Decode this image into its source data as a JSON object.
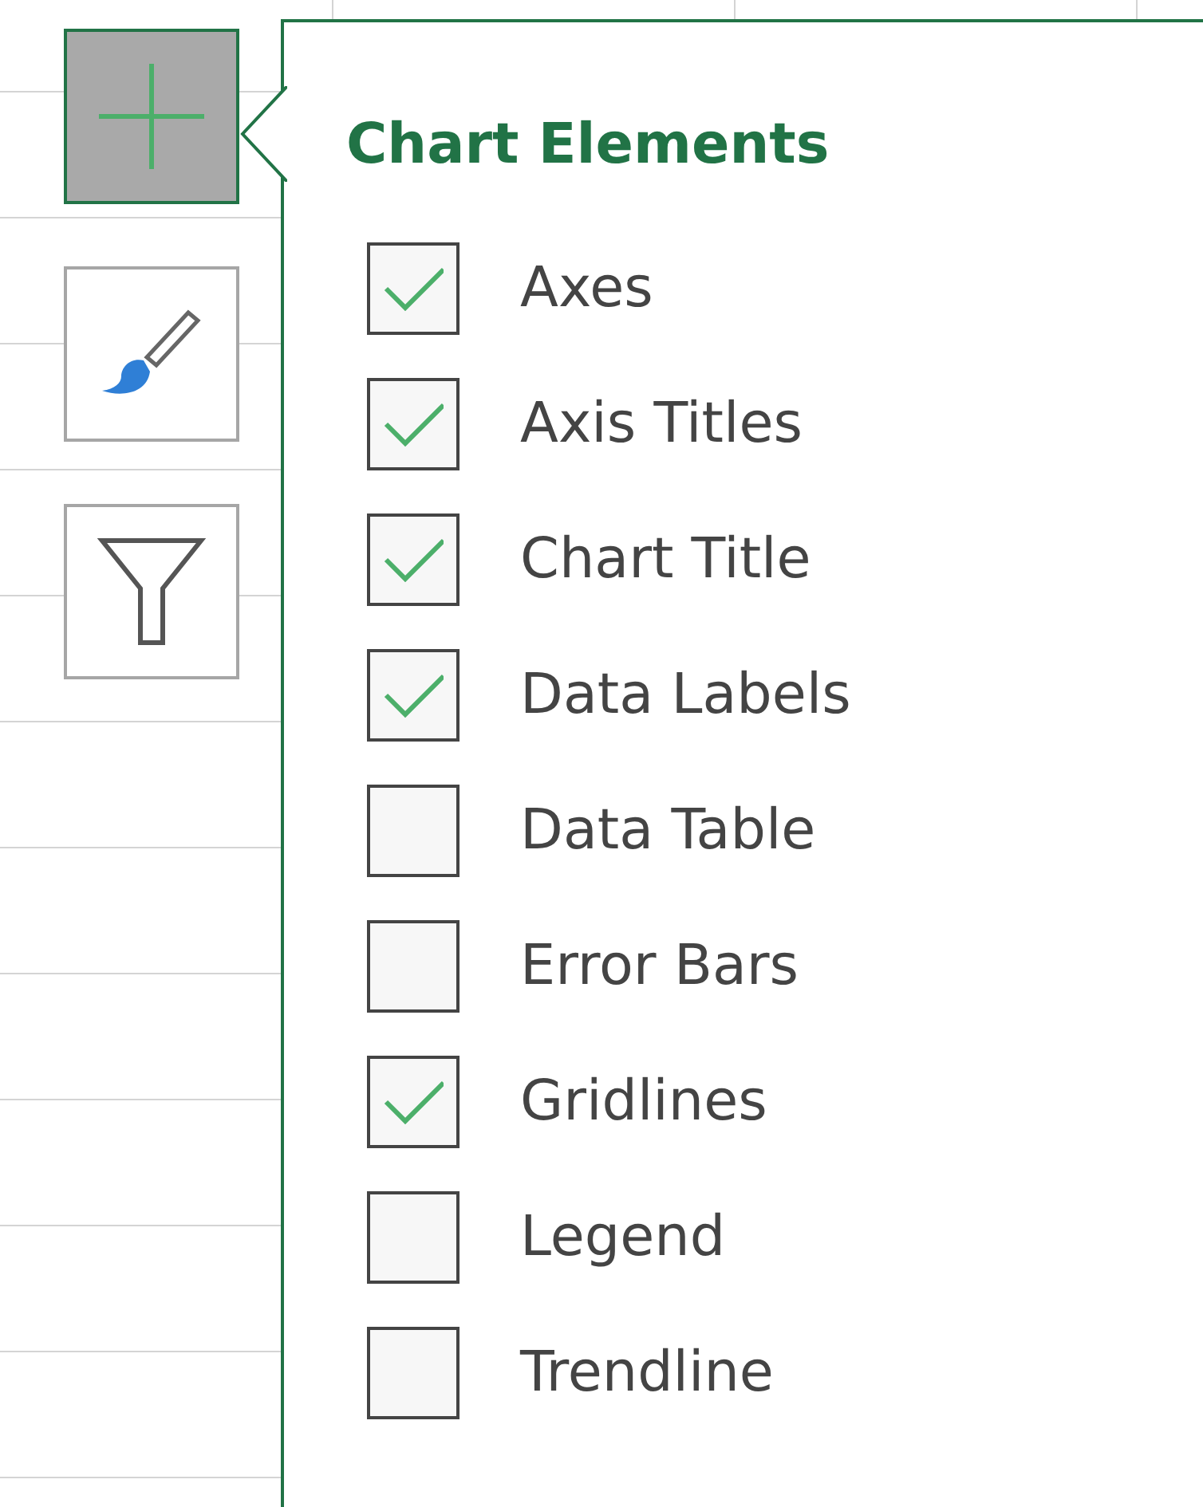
{
  "side_buttons": [
    {
      "kind": "add",
      "selected": true
    },
    {
      "kind": "style",
      "selected": false
    },
    {
      "kind": "filter",
      "selected": false
    }
  ],
  "panel": {
    "title": "Chart Elements",
    "items": [
      {
        "label": "Axes",
        "checked": true
      },
      {
        "label": "Axis Titles",
        "checked": true
      },
      {
        "label": "Chart Title",
        "checked": true
      },
      {
        "label": "Data Labels",
        "checked": true
      },
      {
        "label": "Data Table",
        "checked": false
      },
      {
        "label": "Error Bars",
        "checked": false
      },
      {
        "label": "Gridlines",
        "checked": true
      },
      {
        "label": "Legend",
        "checked": false
      },
      {
        "label": "Trendline",
        "checked": false
      }
    ]
  }
}
